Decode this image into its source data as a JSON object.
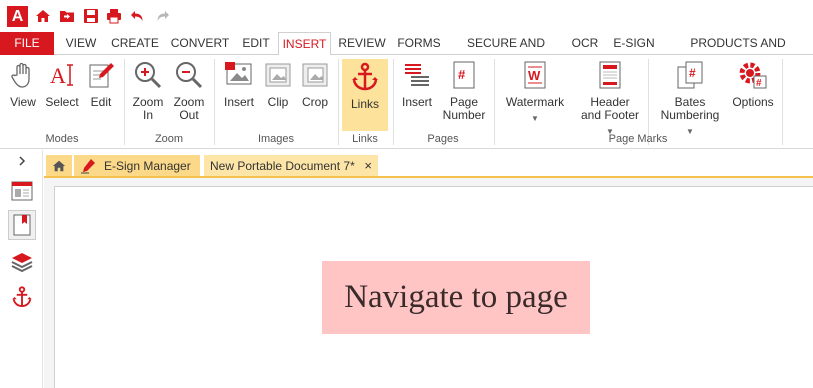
{
  "app": {
    "logo_text": "A"
  },
  "quick_access": [
    {
      "name": "home-icon"
    },
    {
      "name": "open-folder-icon"
    },
    {
      "name": "save-icon"
    },
    {
      "name": "print-icon"
    },
    {
      "name": "undo-icon"
    },
    {
      "name": "redo-icon"
    }
  ],
  "tabs": {
    "file": "FILE",
    "items": [
      "VIEW",
      "CREATE",
      "CONVERT",
      "EDIT",
      "INSERT",
      "REVIEW",
      "FORMS",
      "SECURE AND SIGN",
      "OCR",
      "E-SIGN",
      "PRODUCTS AND PRICING"
    ],
    "active": "INSERT"
  },
  "ribbon": {
    "modes": {
      "label": "Modes",
      "view": "View",
      "select": "Select",
      "edit": "Edit"
    },
    "zoom": {
      "label": "Zoom",
      "zoom_in_1": "Zoom",
      "zoom_in_2": "In",
      "zoom_out_1": "Zoom",
      "zoom_out_2": "Out"
    },
    "images": {
      "label": "Images",
      "insert": "Insert",
      "clip": "Clip",
      "crop": "Crop"
    },
    "links": {
      "label": "Links",
      "links": "Links"
    },
    "pages": {
      "label": "Pages",
      "insert": "Insert",
      "page_number_1": "Page",
      "page_number_2": "Number"
    },
    "page_marks": {
      "label": "Page Marks",
      "watermark": "Watermark",
      "header_footer_1": "Header",
      "header_footer_2": "and Footer",
      "bates_1": "Bates",
      "bates_2": "Numbering",
      "options": "Options"
    }
  },
  "doc_tabs": {
    "esign": "E-Sign Manager",
    "document": "New Portable Document 7*",
    "close": "×"
  },
  "document": {
    "link_text": "Navigate to page"
  },
  "colors": {
    "accent": "#d7191f",
    "active_tab": "#fce29a",
    "doc_tab": "#fbd989",
    "link_box": "#ffc5c5"
  }
}
